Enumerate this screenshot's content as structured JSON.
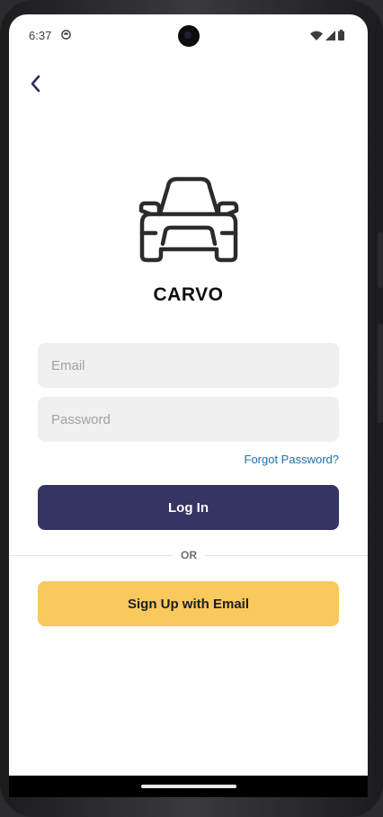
{
  "status_bar": {
    "time": "6:37",
    "app_icon": "circle-app-icon",
    "wifi_icon": "wifi-icon",
    "signal_icon": "signal-icon",
    "battery_icon": "battery-icon"
  },
  "header": {
    "back_icon": "chevron-left-icon"
  },
  "brand": {
    "logo_icon": "car-icon",
    "name": "CARVO"
  },
  "form": {
    "email_placeholder": "Email",
    "email_value": "",
    "password_placeholder": "Password",
    "password_value": "",
    "forgot_label": "Forgot Password?",
    "login_label": "Log In",
    "divider_label": "OR",
    "signup_label": "Sign Up with Email"
  },
  "colors": {
    "primary": "#353462",
    "accent": "#F9C95E",
    "link": "#1F6FA8",
    "field_bg": "#F0F0F0"
  }
}
